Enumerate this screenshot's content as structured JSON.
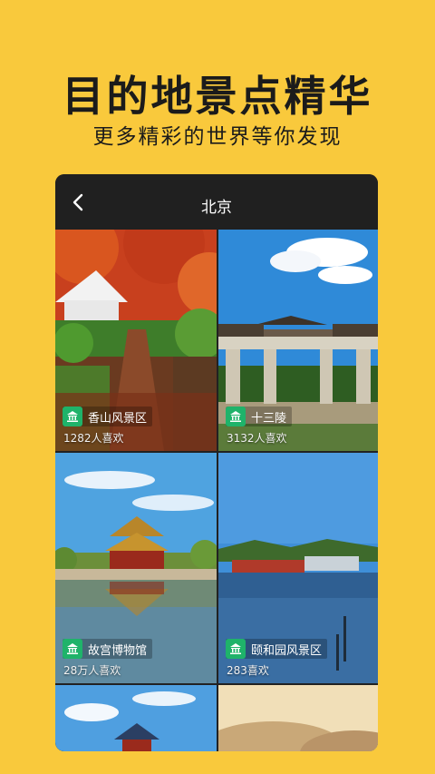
{
  "promo": {
    "headline": "目的地景点精华",
    "subline": "更多精彩的世界等你发现"
  },
  "nav": {
    "title": "北京",
    "back_icon": "chevron-left-icon"
  },
  "spots": [
    {
      "name": "香山风景区",
      "likes": "1282人喜欢",
      "icon": "museum-icon"
    },
    {
      "name": "十三陵",
      "likes": "3132人喜欢",
      "icon": "museum-icon"
    },
    {
      "name": "故宫博物馆",
      "likes": "28万人喜欢",
      "icon": "museum-icon"
    },
    {
      "name": "颐和园风景区",
      "likes": "283喜欢",
      "icon": "museum-icon"
    }
  ],
  "colors": {
    "background": "#F9C93C",
    "tag_icon": "#1FB36A"
  }
}
